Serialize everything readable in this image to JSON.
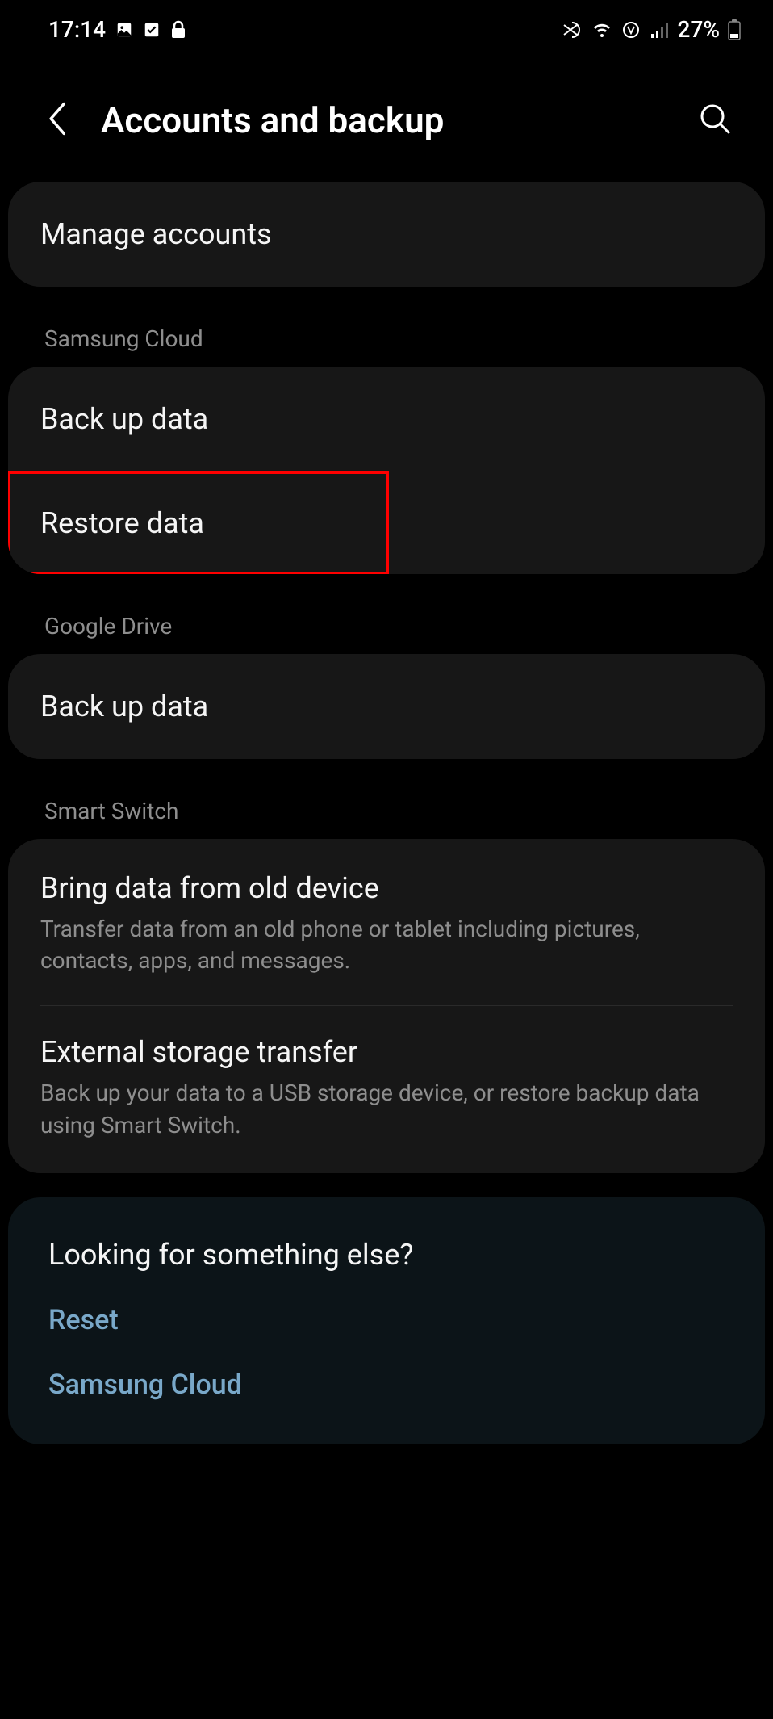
{
  "status": {
    "time": "17:14",
    "battery": "27%"
  },
  "header": {
    "title": "Accounts and backup"
  },
  "manage": {
    "title": "Manage accounts"
  },
  "sections": {
    "samsung_cloud": {
      "label": "Samsung Cloud",
      "backup": "Back up data",
      "restore": "Restore data"
    },
    "google_drive": {
      "label": "Google Drive",
      "backup": "Back up data"
    },
    "smart_switch": {
      "label": "Smart Switch",
      "bring": {
        "title": "Bring data from old device",
        "sub": "Transfer data from an old phone or tablet including pictures, contacts, apps, and messages."
      },
      "external": {
        "title": "External storage transfer",
        "sub": "Back up your data to a USB storage device, or restore backup data using Smart Switch."
      }
    }
  },
  "looking": {
    "title": "Looking for something else?",
    "reset": "Reset",
    "samsung_cloud": "Samsung Cloud"
  }
}
